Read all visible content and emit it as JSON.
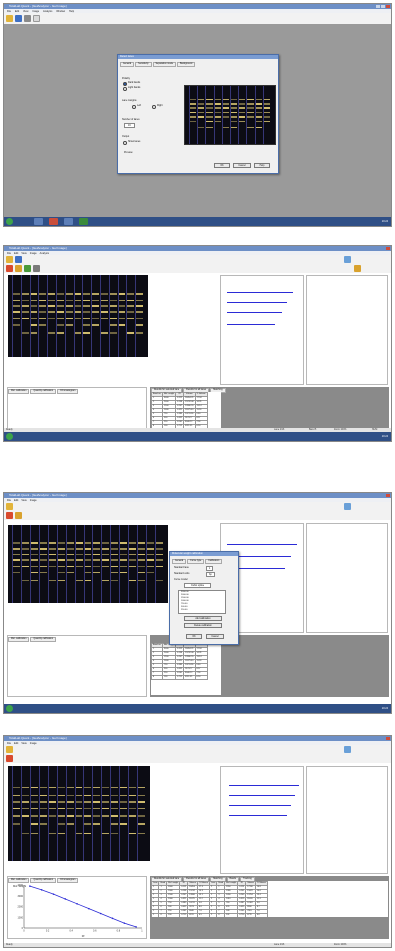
{
  "app": {
    "title": "TotalLab Quant - [GelAnalyzer - Gel Image]",
    "menu": [
      "File",
      "Edit",
      "View",
      "Image",
      "Analysis",
      "Window",
      "Help"
    ]
  },
  "taskbar": {
    "clock": "10:24"
  },
  "dialog_detect": {
    "title": "Detect lanes",
    "tabs": [
      "General",
      "Sensitivity",
      "Separation mode",
      "Background"
    ],
    "section_polarity": "Polarity",
    "opt_dark": "Dark bands",
    "opt_light": "Light bands",
    "section_margins": "Lane margins",
    "opt_left": "Left",
    "opt_right": "Right",
    "section_count": "Number of lanes",
    "count_value": "16",
    "section_output": "Output",
    "opt_show": "Show lanes",
    "chk_preview": "Preview",
    "btn_ok": "OK",
    "btn_cancel": "Cancel",
    "btn_help": "Help"
  },
  "panels": {
    "tab_left": [
      "Mol. calibration",
      "Quantity calibration",
      "Chromatogram"
    ],
    "tab_results": [
      "Results for selected lane",
      "Results for all lanes",
      "Matching",
      "Bands",
      "Tracking",
      "Rf"
    ],
    "status_items": [
      "Ready",
      "Lane 2/16",
      "Band 5",
      "Zoom 100%",
      "NUM"
    ]
  },
  "table_small": {
    "headers": [
      "Band no.",
      "Mol. weight",
      "Rf",
      "Volume",
      "% Volume"
    ],
    "rows": [
      [
        "1",
        "3000",
        "0.112",
        "18454.21",
        "17.34"
      ],
      [
        "2",
        "2000",
        "0.198",
        "15232.08",
        "14.31"
      ],
      [
        "3",
        "1500",
        "0.247",
        "13980.55",
        "13.14"
      ],
      [
        "4",
        "1000",
        "0.321",
        "11875.40",
        "11.16"
      ],
      [
        "5",
        "750",
        "0.389",
        "10211.36",
        "9.60"
      ],
      [
        "6",
        "500",
        "0.452",
        "9123.77",
        "8.57"
      ],
      [
        "7",
        "250",
        "0.561",
        "8040.12",
        "7.56"
      ],
      [
        "8",
        "100",
        "0.712",
        "6911.95",
        "6.50"
      ]
    ]
  },
  "dialog_calib": {
    "title": "Molecular weight calibration",
    "tabs": [
      "General",
      "Curve type",
      "Calibration"
    ],
    "label_standard": "Standard lane",
    "standard_value": "1",
    "label_units": "Standard units",
    "units_value": "bp",
    "label_curve": "Curve model",
    "curve_value": "Cubic spline",
    "values": [
      "3000.00",
      "2000.00",
      "1500.00",
      "1000.00",
      "750.00",
      "500.00",
      "250.00"
    ],
    "btn_add": "Add calibration",
    "btn_delete": "Delete calibration",
    "btn_ok": "OK",
    "btn_cancel": "Cancel"
  },
  "chart_data": {
    "type": "line",
    "title": "",
    "xlabel": "Rf",
    "ylabel": "Mol. weight",
    "x": [
      0.05,
      0.15,
      0.25,
      0.35,
      0.45,
      0.55,
      0.65,
      0.75,
      0.85,
      0.95
    ],
    "series": [
      {
        "values": [
          3900,
          3550,
          3150,
          2700,
          2250,
          1800,
          1350,
          900,
          450,
          100
        ]
      }
    ],
    "xlim": [
      0,
      1
    ],
    "ylim": [
      0,
      4000
    ],
    "grid": false
  },
  "table_wide": {
    "headers": [
      "Lane",
      "Band",
      "Mol. weight",
      "Rf",
      "Volume",
      "% Volume",
      "Lane",
      "Band",
      "Mol. weight",
      "Rf",
      "Volume",
      "% Volume"
    ],
    "rows": [
      [
        "1",
        "1",
        "3000",
        "0.112",
        "18454",
        "17.3",
        "2",
        "1",
        "2950",
        "0.115",
        "17310",
        "16.8"
      ],
      [
        "1",
        "2",
        "2000",
        "0.198",
        "15232",
        "14.3",
        "2",
        "2",
        "1980",
        "0.201",
        "15022",
        "14.6"
      ],
      [
        "1",
        "3",
        "1500",
        "0.247",
        "13980",
        "13.1",
        "2",
        "3",
        "1490",
        "0.249",
        "13754",
        "13.4"
      ],
      [
        "1",
        "4",
        "1000",
        "0.321",
        "11875",
        "11.2",
        "2",
        "4",
        "1010",
        "0.319",
        "11620",
        "11.3"
      ],
      [
        "1",
        "5",
        "750",
        "0.389",
        "10211",
        "9.6",
        "2",
        "5",
        "760",
        "0.387",
        "10102",
        "9.8"
      ],
      [
        "1",
        "6",
        "500",
        "0.452",
        "9123",
        "8.6",
        "2",
        "6",
        "495",
        "0.455",
        "8990",
        "8.7"
      ],
      [
        "1",
        "7",
        "250",
        "0.561",
        "8040",
        "7.6",
        "2",
        "7",
        "248",
        "0.563",
        "7801",
        "7.6"
      ],
      [
        "1",
        "8",
        "100",
        "0.712",
        "6911",
        "6.5",
        "2",
        "8",
        "102",
        "0.710",
        "6770",
        "6.6"
      ]
    ]
  }
}
